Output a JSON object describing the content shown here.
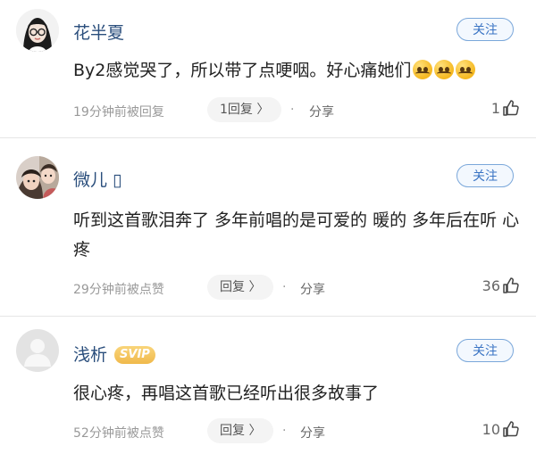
{
  "comments": [
    {
      "username": "花半夏",
      "badge": "",
      "follow_label": "关注",
      "text": "By2感觉哭了，所以带了点哽咽。好心痛她们",
      "emoji": [
        "sad-emoji",
        "sad-emoji",
        "sad-emoji"
      ],
      "time": "19分钟前被回复",
      "reply_label": "1回复 〉",
      "dot": "·",
      "share_label": "分享",
      "like_count": "1",
      "avatar": "girl-with-glasses-avatar"
    },
    {
      "username": "微儿 ▯",
      "badge": "",
      "follow_label": "关注",
      "text": "听到这首歌泪奔了 多年前唱的是可爱的 暖的 多年后在听 心疼",
      "emoji": [],
      "time": "29分钟前被点赞",
      "reply_label": "回复 〉",
      "dot": "·",
      "share_label": "分享",
      "like_count": "36",
      "avatar": "family-photo-avatar"
    },
    {
      "username": "浅析",
      "badge": "SVIP",
      "follow_label": "关注",
      "text": "很心疼，再唱这首歌已经听出很多故事了",
      "emoji": [],
      "time": "52分钟前被点赞",
      "reply_label": "回复 〉",
      "dot": "·",
      "share_label": "分享",
      "like_count": "10",
      "avatar": "default-user-avatar"
    }
  ],
  "colors": {
    "username": "#2a4e7c",
    "follow": "#3a74c4",
    "svip": "#f0b94b"
  }
}
